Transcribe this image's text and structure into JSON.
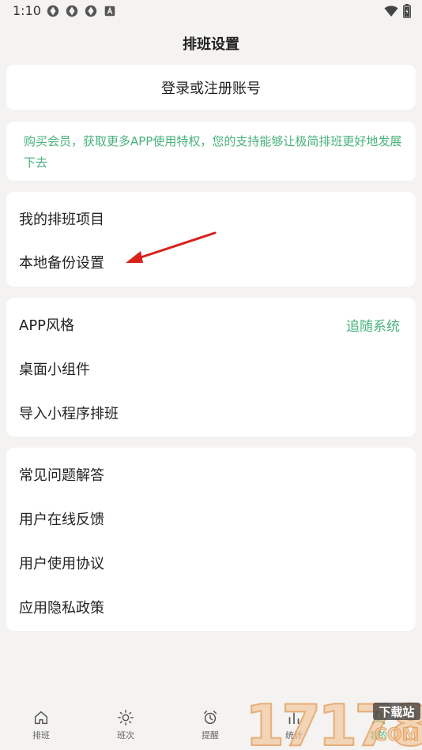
{
  "status_bar": {
    "time": "1:10"
  },
  "header": {
    "title": "排班设置"
  },
  "login": {
    "label": "登录或注册账号"
  },
  "vip": {
    "text": "购买会员，获取更多APP使用特权，您的支持能够让极简排班更好地发展下去"
  },
  "menu_group_1": {
    "items": [
      {
        "label": "我的排班项目"
      },
      {
        "label": "本地备份设置"
      }
    ]
  },
  "menu_group_2": {
    "items": [
      {
        "label": "APP风格",
        "value": "追随系统"
      },
      {
        "label": "桌面小组件"
      },
      {
        "label": "导入小程序排班"
      }
    ]
  },
  "menu_group_3": {
    "items": [
      {
        "label": "常见问题解答"
      },
      {
        "label": "用户在线反馈"
      },
      {
        "label": "用户使用协议"
      },
      {
        "label": "应用隐私政策"
      }
    ]
  },
  "bottom_nav": {
    "items": [
      {
        "label": "排班",
        "icon": "home-icon"
      },
      {
        "label": "班次",
        "icon": "sun-icon"
      },
      {
        "label": "提醒",
        "icon": "alarm-icon"
      },
      {
        "label": "统计",
        "icon": "chart-icon"
      },
      {
        "label": "我的",
        "icon": "user-icon"
      }
    ]
  },
  "watermark": {
    "number": "17178",
    "text": "下载站",
    "domain": "COM"
  },
  "colors": {
    "accent": "#47b27b",
    "background": "#f4f3f1",
    "annotation_arrow": "#d9211c"
  }
}
